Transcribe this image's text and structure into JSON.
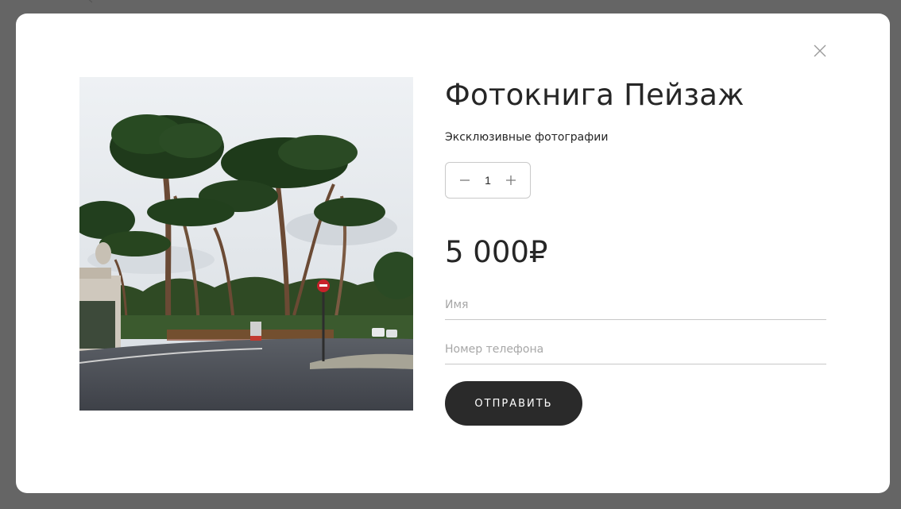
{
  "modal": {
    "title": "Фотокнига Пейзаж",
    "subtitle": "Эксклюзивные фотографии",
    "quantity": "1",
    "price": "5 000₽",
    "image_icon": "landscape-photo",
    "form": {
      "name_placeholder": "Имя",
      "phone_placeholder": "Номер телефона",
      "submit_label": "ОТПРАВИТЬ"
    },
    "icons": {
      "close": "close-icon",
      "minus": "minus-icon",
      "plus": "plus-icon"
    }
  },
  "colors": {
    "backdrop": "#656565",
    "modal_bg": "#ffffff",
    "text": "#262626",
    "button_bg": "#2a2a2a",
    "button_text": "#ffffff",
    "placeholder": "#a7a7a7",
    "border": "#c8c8c8"
  }
}
